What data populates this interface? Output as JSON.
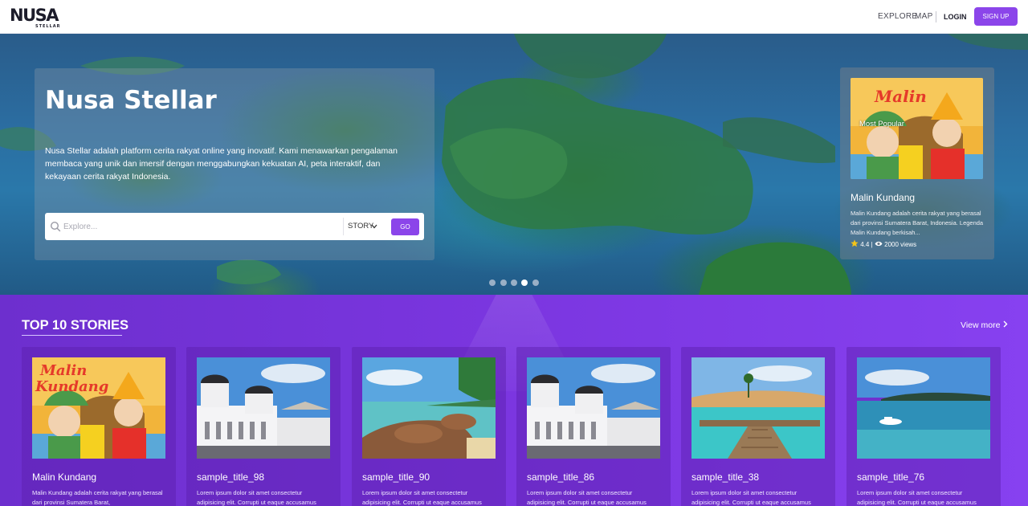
{
  "navbar": {
    "logo_text": "NUSA",
    "logo_subtext": "STELLAR",
    "explore": "EXPLORE",
    "map": "MAP",
    "login": "LOGIN",
    "signup": "SIGN UP"
  },
  "hero": {
    "title": "Nusa Stellar",
    "description": "Nusa Stellar adalah platform cerita rakyat online yang inovatif. Kami menawarkan pengalaman membaca yang unik dan imersif dengan menggabungkan kekuatan AI, peta interaktif, dan kekayaan cerita rakyat Indonesia.",
    "search": {
      "placeholder": "Explore...",
      "type_selected": "STORY",
      "go_label": "GO"
    },
    "slides_total": 5,
    "slide_active": 4,
    "popular": {
      "tag": "Most Popular",
      "title": "Malin Kundang",
      "description": "Malin Kundang adalah cerita rakyat yang berasal dari provinsi Sumatera Barat, Indonesia. Legenda Malin Kundang berkisah...",
      "rating": "4.4",
      "separator": "|",
      "views": "2000 views"
    }
  },
  "top_stories": {
    "heading": "TOP 10 STORIES",
    "view_more": "View more",
    "cards": [
      {
        "title": "Malin Kundang",
        "description": "Malin Kundang adalah cerita rakyat yang berasal dari provinsi Sumatera Barat,"
      },
      {
        "title": "sample_title_98",
        "description": "Lorem ipsum dolor sit amet consectetur adipisicing elit. Corrupti ut eaque accusamus"
      },
      {
        "title": "sample_title_90",
        "description": "Lorem ipsum dolor sit amet consectetur adipisicing elit. Corrupti ut eaque accusamus"
      },
      {
        "title": "sample_title_86",
        "description": "Lorem ipsum dolor sit amet consectetur adipisicing elit. Corrupti ut eaque accusamus"
      },
      {
        "title": "sample_title_38",
        "description": "Lorem ipsum dolor sit amet consectetur adipisicing elit. Corrupti ut eaque accusamus"
      },
      {
        "title": "sample_title_76",
        "description": "Lorem ipsum dolor sit amet consectetur adipisicing elit. Corrupti ut eaque accusamus"
      }
    ]
  },
  "colors": {
    "accent": "#8b45ea",
    "stories_bg": "#7b36e0",
    "star": "#f5c518"
  },
  "icons": [
    "search-icon",
    "chevron-down-icon",
    "star-icon",
    "eye-icon",
    "chevron-right-icon"
  ]
}
